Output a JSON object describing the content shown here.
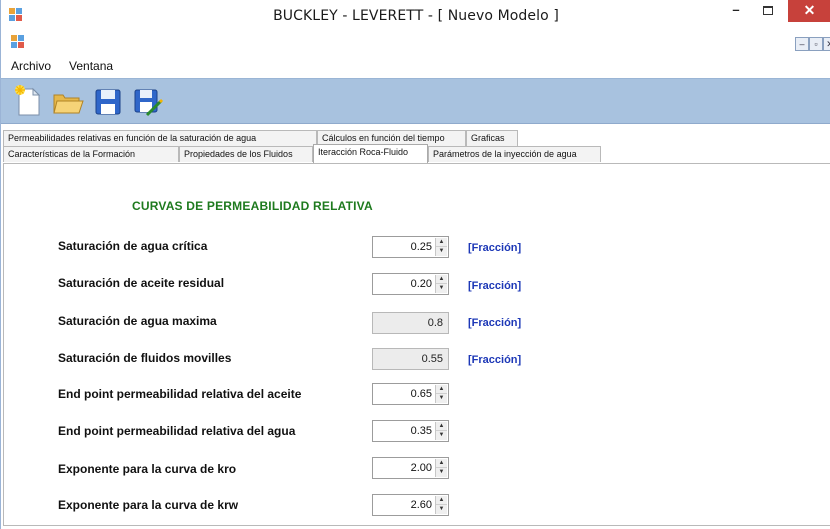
{
  "window": {
    "title": "BUCKLEY - LEVERETT - [ Nuevo Modelo ]"
  },
  "menu": {
    "items": [
      "Archivo",
      "Ventana"
    ]
  },
  "toolbar": {
    "icons": [
      "new-file-icon",
      "open-folder-icon",
      "save-icon",
      "save-as-icon"
    ],
    "colors": {
      "background": "#a8c2df",
      "close": "#c7413b"
    }
  },
  "tabs": {
    "row1": [
      "Permeabilidades relativas en función de la saturación de agua",
      "Cálculos en función del tiempo",
      "Graficas"
    ],
    "row2": [
      "Características de la Formación",
      "Propiedades de los Fluidos",
      "Iteracción Roca-Fluido",
      "Parámetros de la inyección de agua"
    ],
    "active": "Iteracción Roca-Fluido"
  },
  "section": {
    "title": "CURVAS DE PERMEABILIDAD RELATIVA"
  },
  "fields": [
    {
      "label": "Saturación de agua crítica",
      "value": "0.25",
      "unit": "[Fracción]"
    },
    {
      "label": "Saturación de aceite residual",
      "value": "0.20",
      "unit": "[Fracción]"
    },
    {
      "label": "Saturación de agua maxima",
      "value": "0.8",
      "unit": "[Fracción]"
    },
    {
      "label": "Saturación de fluidos movilles",
      "value": "0.55",
      "unit": "[Fracción]"
    },
    {
      "label": "End point permeabilidad relativa del aceite",
      "value": "0.65"
    },
    {
      "label": "End point permeabilidad relativa del agua",
      "value": "0.35"
    },
    {
      "label": "Exponente para la curva de kro",
      "value": "2.00"
    },
    {
      "label": "Exponente para la curva de krw",
      "value": "2.60"
    }
  ]
}
